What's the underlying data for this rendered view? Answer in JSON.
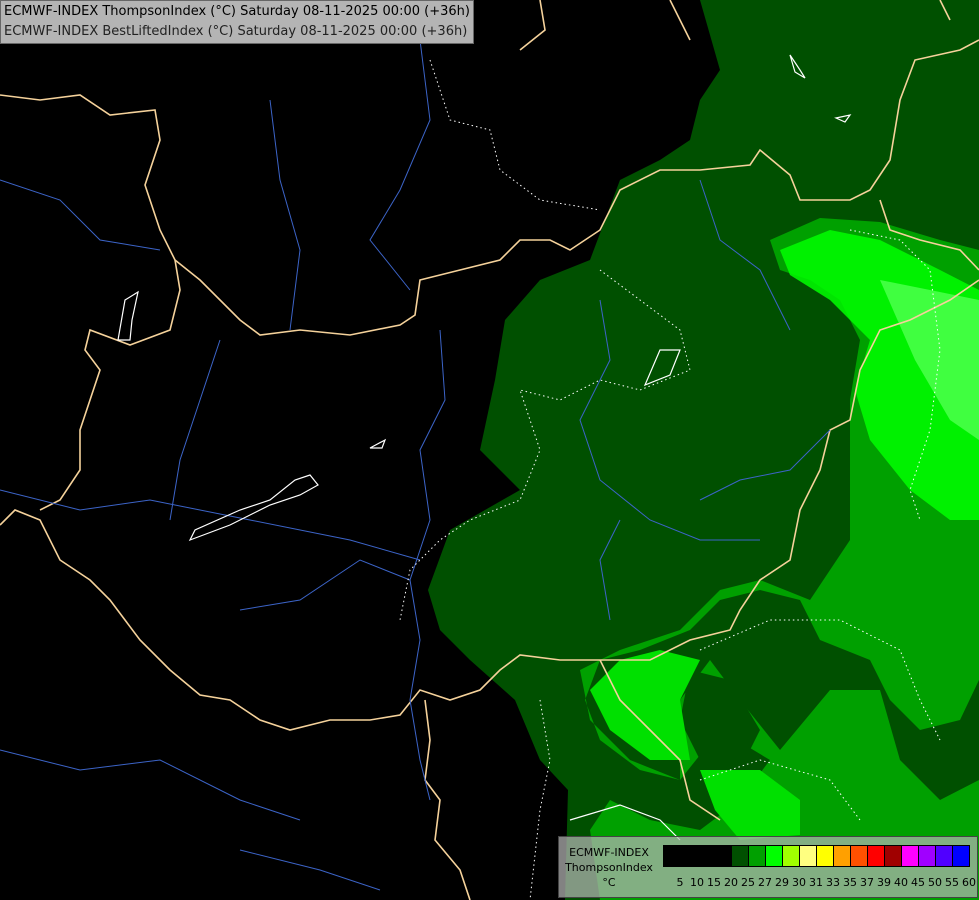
{
  "title": {
    "line1": "ECMWF-INDEX ThompsonIndex (°C) Saturday 08-11-2025 00:00 (+36h)",
    "line2": "ECMWF-INDEX BestLiftedIndex (°C) Saturday 08-11-2025 00:00 (+36h)"
  },
  "legend": {
    "model": "ECMWF-INDEX",
    "parameter": "ThompsonIndex",
    "unit": "°C",
    "colors": [
      "#000000",
      "#000000",
      "#000000",
      "#000000",
      "#005000",
      "#00a000",
      "#00ff00",
      "#a0ff00",
      "#ffff80",
      "#ffff00",
      "#ffa000",
      "#ff5000",
      "#ff0000",
      "#a00000",
      "#ff00ff",
      "#a000ff",
      "#5000ff",
      "#0000ff"
    ],
    "ticks": [
      "5",
      "10",
      "15",
      "20",
      "25",
      "27",
      "29",
      "30",
      "31",
      "33",
      "35",
      "37",
      "39",
      "40",
      "45",
      "50",
      "55",
      "60"
    ]
  },
  "colors": {
    "background": "#000000",
    "level25": "#005000",
    "level27": "#00a000",
    "level29": "#00ff00",
    "border": "#f5d29b",
    "river": "#3c64c8"
  }
}
